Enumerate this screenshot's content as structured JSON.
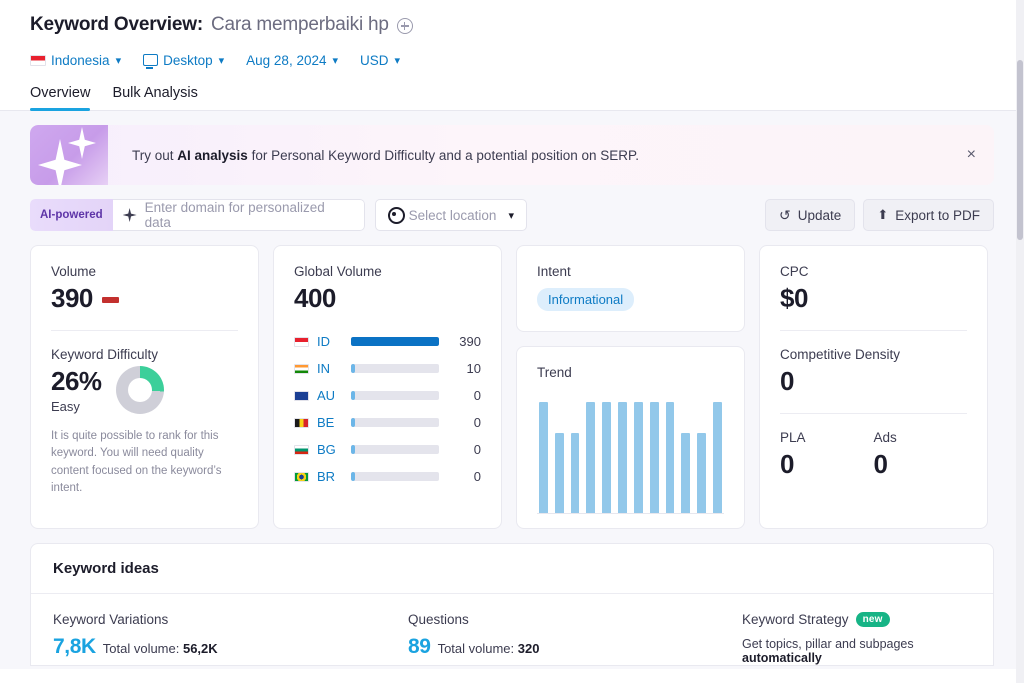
{
  "header": {
    "title_main": "Keyword Overview:",
    "keyword": "Cara memperbaiki hp",
    "add_icon": "plus-circle-icon",
    "filters": {
      "country": "Indonesia",
      "device": "Desktop",
      "date": "Aug 28, 2024",
      "currency": "USD"
    }
  },
  "tabs": [
    {
      "label": "Overview",
      "active": true
    },
    {
      "label": "Bulk Analysis",
      "active": false
    }
  ],
  "banner": {
    "text_prefix": "Try out ",
    "text_bold": "AI analysis",
    "text_suffix": " for Personal Keyword Difficulty and a potential position on SERP.",
    "close_label": "×",
    "icon": "sparkle-icon"
  },
  "toolbar": {
    "ai_badge": "AI-powered",
    "domain_placeholder": "Enter domain for personalized data",
    "domain_value": "",
    "location_placeholder": "Select location",
    "update_label": "Update",
    "export_label": "Export to PDF"
  },
  "volume_card": {
    "label": "Volume",
    "value": "390",
    "trend": "flat"
  },
  "kd_card": {
    "label": "Keyword Difficulty",
    "value": "26%",
    "level": "Easy",
    "percent": 26,
    "description": "It is quite possible to rank for this keyword. You will need quality content focused on the keyword’s intent."
  },
  "global_volume": {
    "label": "Global Volume",
    "value": "400",
    "rows": [
      {
        "code": "ID",
        "volume": "390",
        "pct": 100
      },
      {
        "code": "IN",
        "volume": "10",
        "pct": 4
      },
      {
        "code": "AU",
        "volume": "0",
        "pct": 4
      },
      {
        "code": "BE",
        "volume": "0",
        "pct": 4
      },
      {
        "code": "BG",
        "volume": "0",
        "pct": 4
      },
      {
        "code": "BR",
        "volume": "0",
        "pct": 4
      }
    ]
  },
  "intent_card": {
    "label": "Intent",
    "value": "Informational"
  },
  "trend_card": {
    "label": "Trend"
  },
  "chart_data": {
    "type": "bar",
    "title": "Trend",
    "categories": [
      "1",
      "2",
      "3",
      "4",
      "5",
      "6",
      "7",
      "8",
      "9",
      "10",
      "11",
      "12"
    ],
    "values": [
      100,
      72,
      72,
      100,
      100,
      100,
      100,
      100,
      100,
      72,
      72,
      100
    ],
    "xlabel": "",
    "ylabel": "",
    "ylim": [
      0,
      100
    ],
    "grid": false,
    "legend": "none",
    "color": "#92c8ea"
  },
  "cpc_card": {
    "cpc_label": "CPC",
    "cpc_value": "$0",
    "density_label": "Competitive Density",
    "density_value": "0",
    "pla_label": "PLA",
    "pla_value": "0",
    "ads_label": "Ads",
    "ads_value": "0"
  },
  "ideas": {
    "title": "Keyword ideas",
    "variations_label": "Keyword Variations",
    "variations_count": "7,8K",
    "variations_total_prefix": "Total volume: ",
    "variations_total": "56,2K",
    "questions_label": "Questions",
    "questions_count": "89",
    "questions_total_prefix": "Total volume: ",
    "questions_total": "320",
    "strategy_label": "Keyword Strategy",
    "strategy_badge": "new",
    "strategy_desc_prefix": "Get topics, pillar and subpages ",
    "strategy_desc_bold": "automatically"
  },
  "colors": {
    "link_blue": "#0e7bc4",
    "accent_blue": "#1aa3e0",
    "bar_blue": "#0b72c4",
    "trend_bar": "#92c8ea",
    "kd_green": "#3ccf9a",
    "new_green": "#17b486",
    "red_flat": "#c3302e",
    "ai_purple": "#c79ce9"
  }
}
